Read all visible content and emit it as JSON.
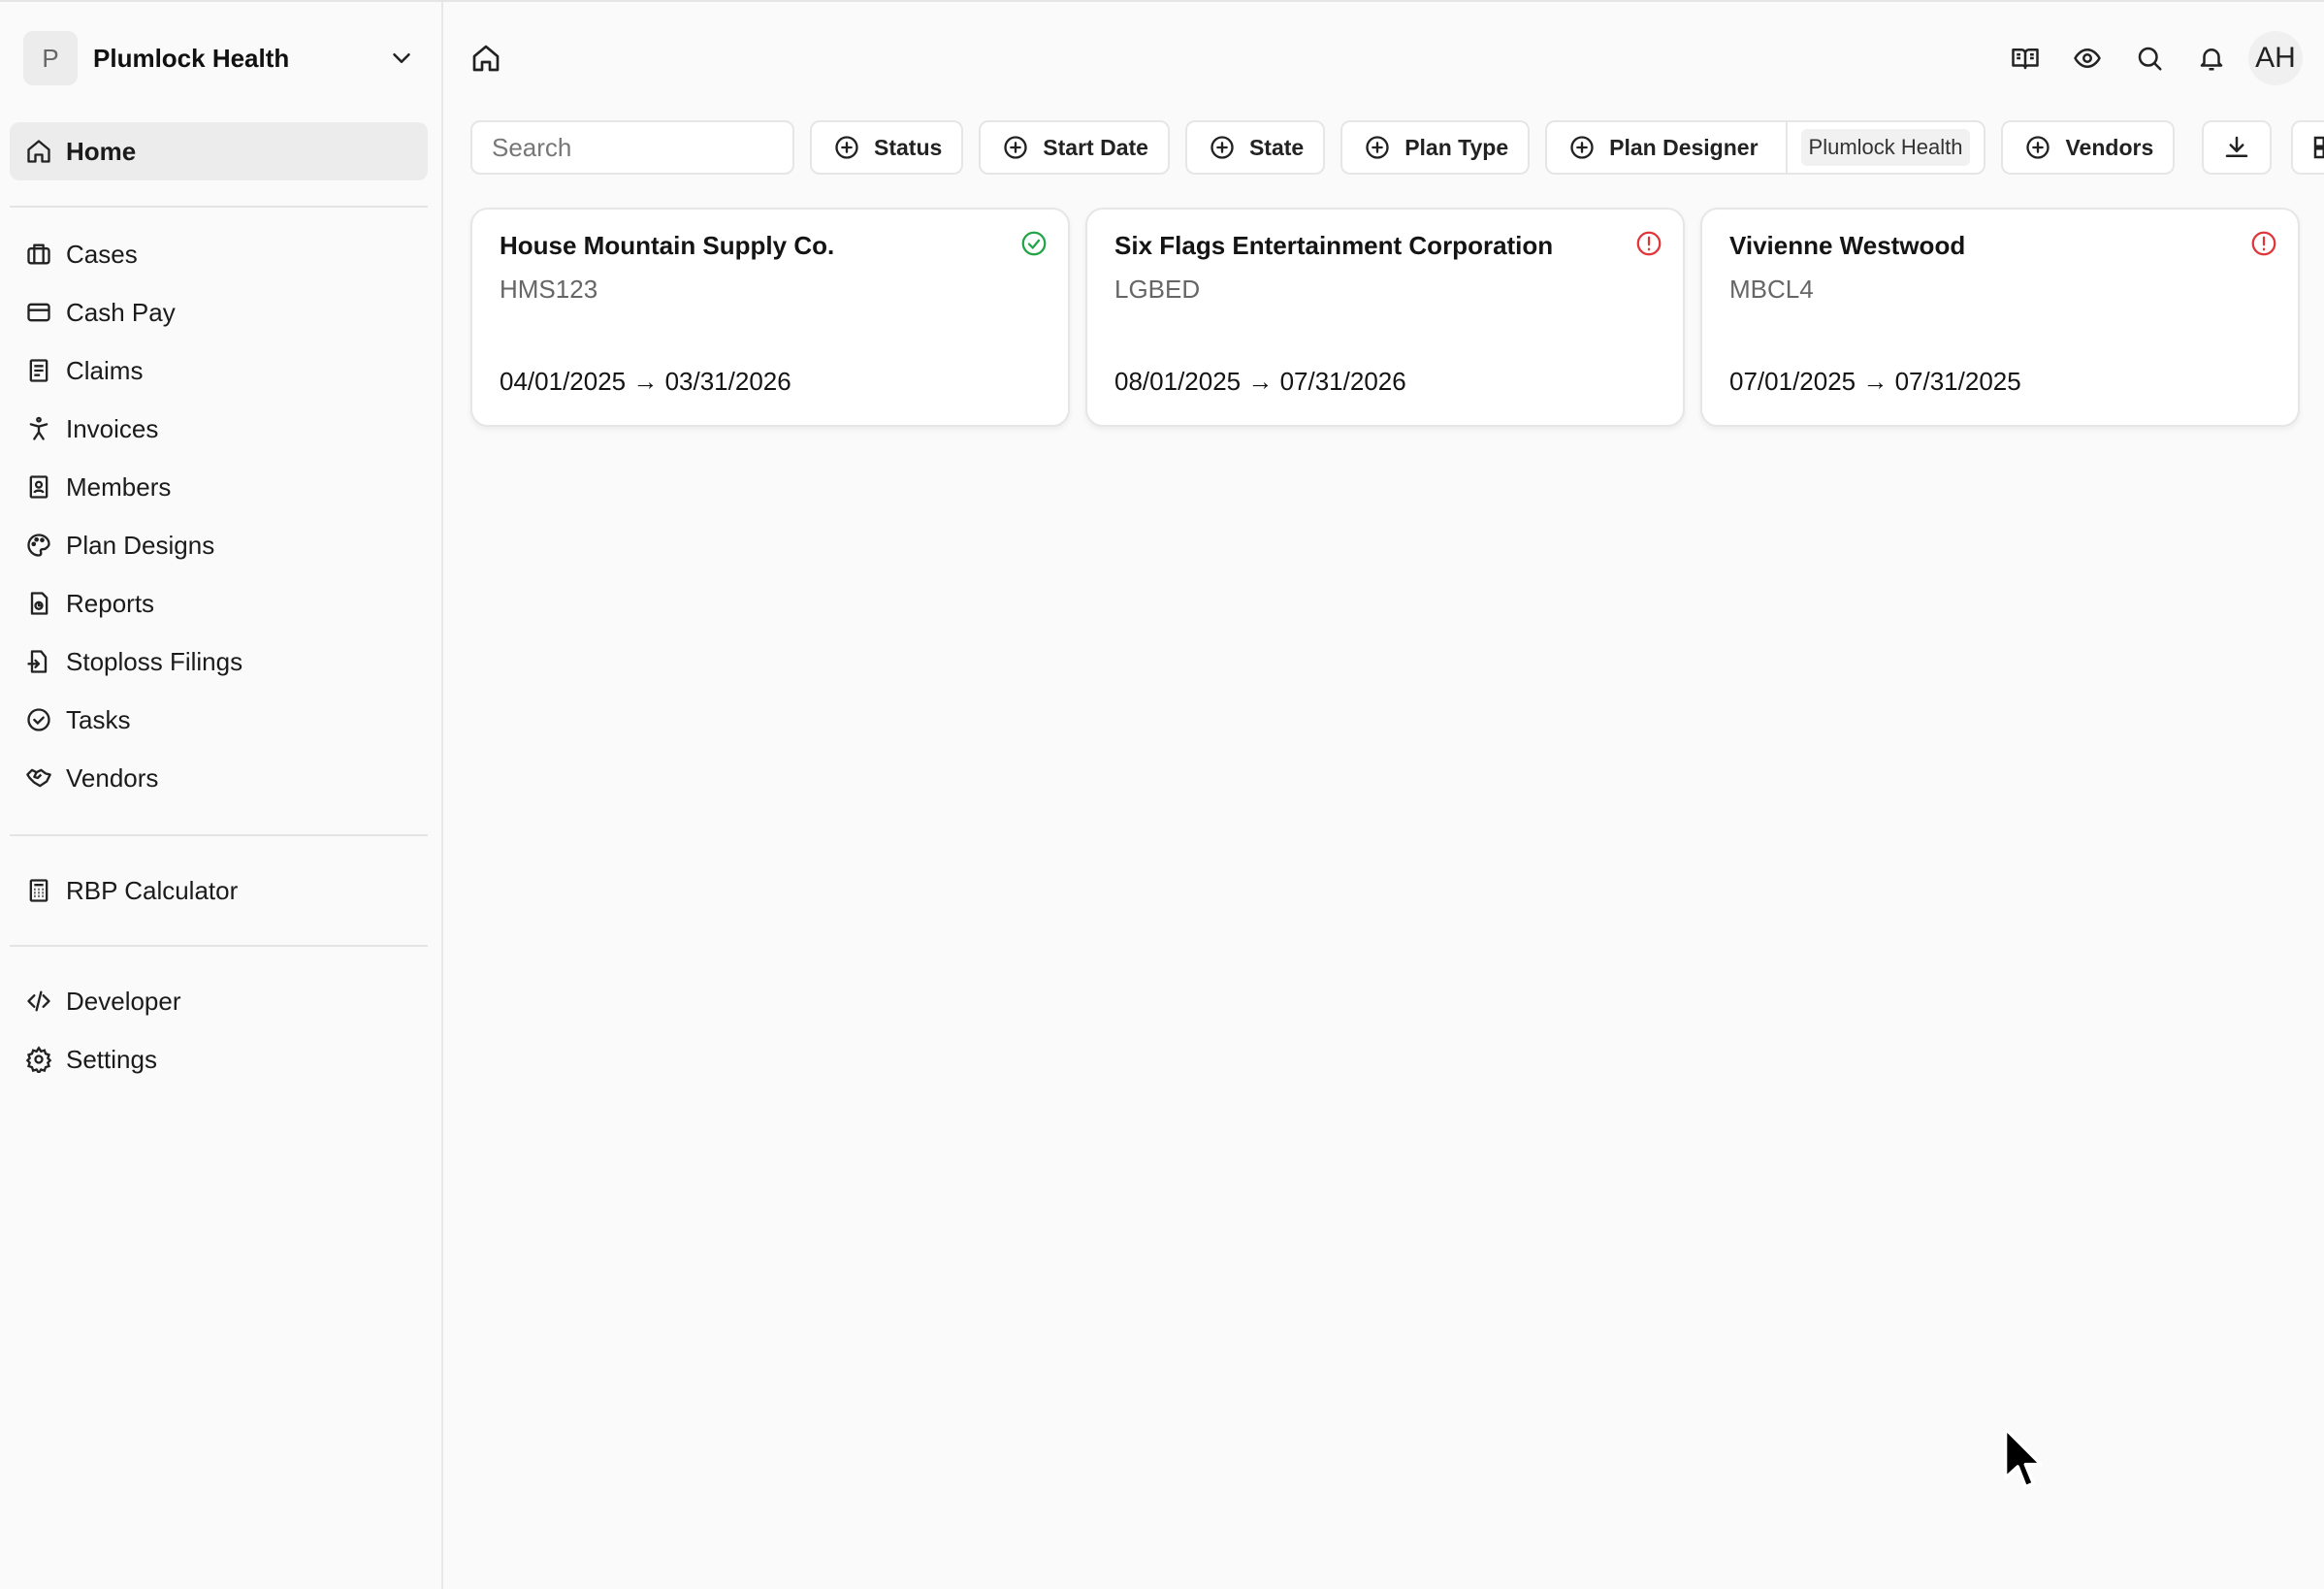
{
  "org": {
    "initial": "P",
    "name": "Plumlock Health"
  },
  "nav": {
    "home": "Home",
    "main": [
      {
        "label": "Cases",
        "icon": "briefcase-icon"
      },
      {
        "label": "Cash Pay",
        "icon": "credit-card-icon"
      },
      {
        "label": "Claims",
        "icon": "receipt-icon"
      },
      {
        "label": "Invoices",
        "icon": "person-icon"
      },
      {
        "label": "Members",
        "icon": "contact-icon"
      },
      {
        "label": "Plan Designs",
        "icon": "palette-icon"
      },
      {
        "label": "Reports",
        "icon": "file-chart-icon"
      },
      {
        "label": "Stoploss Filings",
        "icon": "file-export-icon"
      },
      {
        "label": "Tasks",
        "icon": "check-circle-icon"
      },
      {
        "label": "Vendors",
        "icon": "handshake-icon"
      }
    ],
    "tools": [
      {
        "label": "RBP Calculator",
        "icon": "calculator-icon"
      }
    ],
    "bottom": [
      {
        "label": "Developer",
        "icon": "code-icon"
      },
      {
        "label": "Settings",
        "icon": "gear-icon"
      }
    ]
  },
  "topbar": {
    "user_initials": "AH"
  },
  "filters": {
    "search_placeholder": "Search",
    "status": "Status",
    "start_date": "Start Date",
    "state": "State",
    "plan_type": "Plan Type",
    "plan_designer": "Plan Designer",
    "plan_designer_value": "Plumlock Health",
    "vendors": "Vendors"
  },
  "cards": [
    {
      "title": "House Mountain Supply Co.",
      "code": "HMS123",
      "dates": "04/01/2025 → 03/31/2026",
      "status": "ok",
      "status_color": "#22a447"
    },
    {
      "title": "Six Flags Entertainment Corporation",
      "code": "LGBED",
      "dates": "08/01/2025 → 07/31/2026",
      "status": "alert",
      "status_color": "#e0363a"
    },
    {
      "title": "Vivienne Westwood",
      "code": "MBCL4",
      "dates": "07/01/2025 → 07/31/2025",
      "status": "alert",
      "status_color": "#e0363a"
    }
  ]
}
